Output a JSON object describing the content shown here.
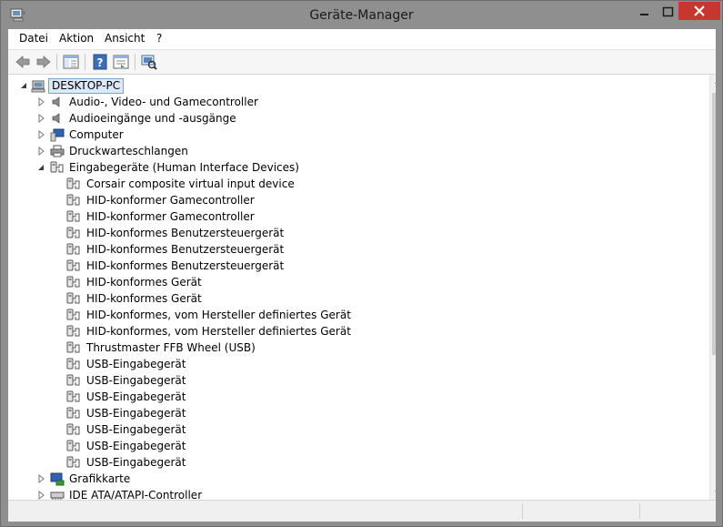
{
  "window": {
    "title": "Geräte-Manager",
    "accent_close": "#c7372f",
    "frame_color": "#8f8f8f"
  },
  "menu": [
    {
      "label": "Datei"
    },
    {
      "label": "Aktion"
    },
    {
      "label": "Ansicht"
    },
    {
      "label": "?"
    }
  ],
  "toolbar": {
    "buttons": [
      "back-icon",
      "forward-icon",
      "show-hide-console-tree-icon",
      "help-icon",
      "properties-icon",
      "scan-hardware-icon"
    ]
  },
  "tree": {
    "root": {
      "label": "DESKTOP-PC",
      "icon": "computer-icon",
      "expanded": true
    },
    "categories": [
      {
        "label": "Audio-, Video- und Gamecontroller",
        "icon": "speaker-icon",
        "expanded": false
      },
      {
        "label": "Audioeingänge und -ausgänge",
        "icon": "speaker-icon",
        "expanded": false
      },
      {
        "label": "Computer",
        "icon": "monitor-icon",
        "expanded": false
      },
      {
        "label": "Druckwarteschlangen",
        "icon": "printer-icon",
        "expanded": false
      },
      {
        "label": "Eingabegeräte (Human Interface Devices)",
        "icon": "hid-icon",
        "expanded": true
      }
    ],
    "hid_children": [
      "Corsair composite virtual input device",
      "HID-konformer Gamecontroller",
      "HID-konformer Gamecontroller",
      "HID-konformes Benutzersteuergerät",
      "HID-konformes Benutzersteuergerät",
      "HID-konformes Benutzersteuergerät",
      "HID-konformes Gerät",
      "HID-konformes Gerät",
      "HID-konformes, vom Hersteller definiertes Gerät",
      "HID-konformes, vom Hersteller definiertes Gerät",
      "Thrustmaster FFB Wheel (USB)",
      "USB-Eingabegerät",
      "USB-Eingabegerät",
      "USB-Eingabegerät",
      "USB-Eingabegerät",
      "USB-Eingabegerät",
      "USB-Eingabegerät",
      "USB-Eingabegerät"
    ],
    "after": [
      {
        "label": "Grafikkarte",
        "icon": "display-adapter-icon",
        "expanded": false
      },
      {
        "label": "IDE ATA/ATAPI-Controller",
        "icon": "ide-controller-icon",
        "expanded": false
      }
    ]
  }
}
